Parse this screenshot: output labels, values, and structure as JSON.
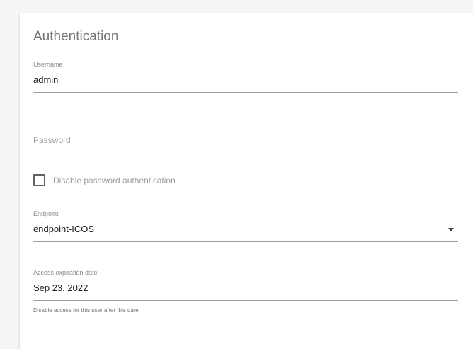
{
  "section": {
    "title": "Authentication"
  },
  "username": {
    "label": "Username",
    "value": "admin"
  },
  "password": {
    "placeholder": "Password",
    "value": ""
  },
  "disable_password": {
    "label": "Disable password authentication",
    "checked": false
  },
  "endpoint": {
    "label": "Endpoint",
    "value": "endpoint-ICOS",
    "icon": "caret-down-icon"
  },
  "expiration": {
    "label": "Access expiration date",
    "value": "Sep 23, 2022",
    "helper": "Disable access for this user after this date."
  }
}
